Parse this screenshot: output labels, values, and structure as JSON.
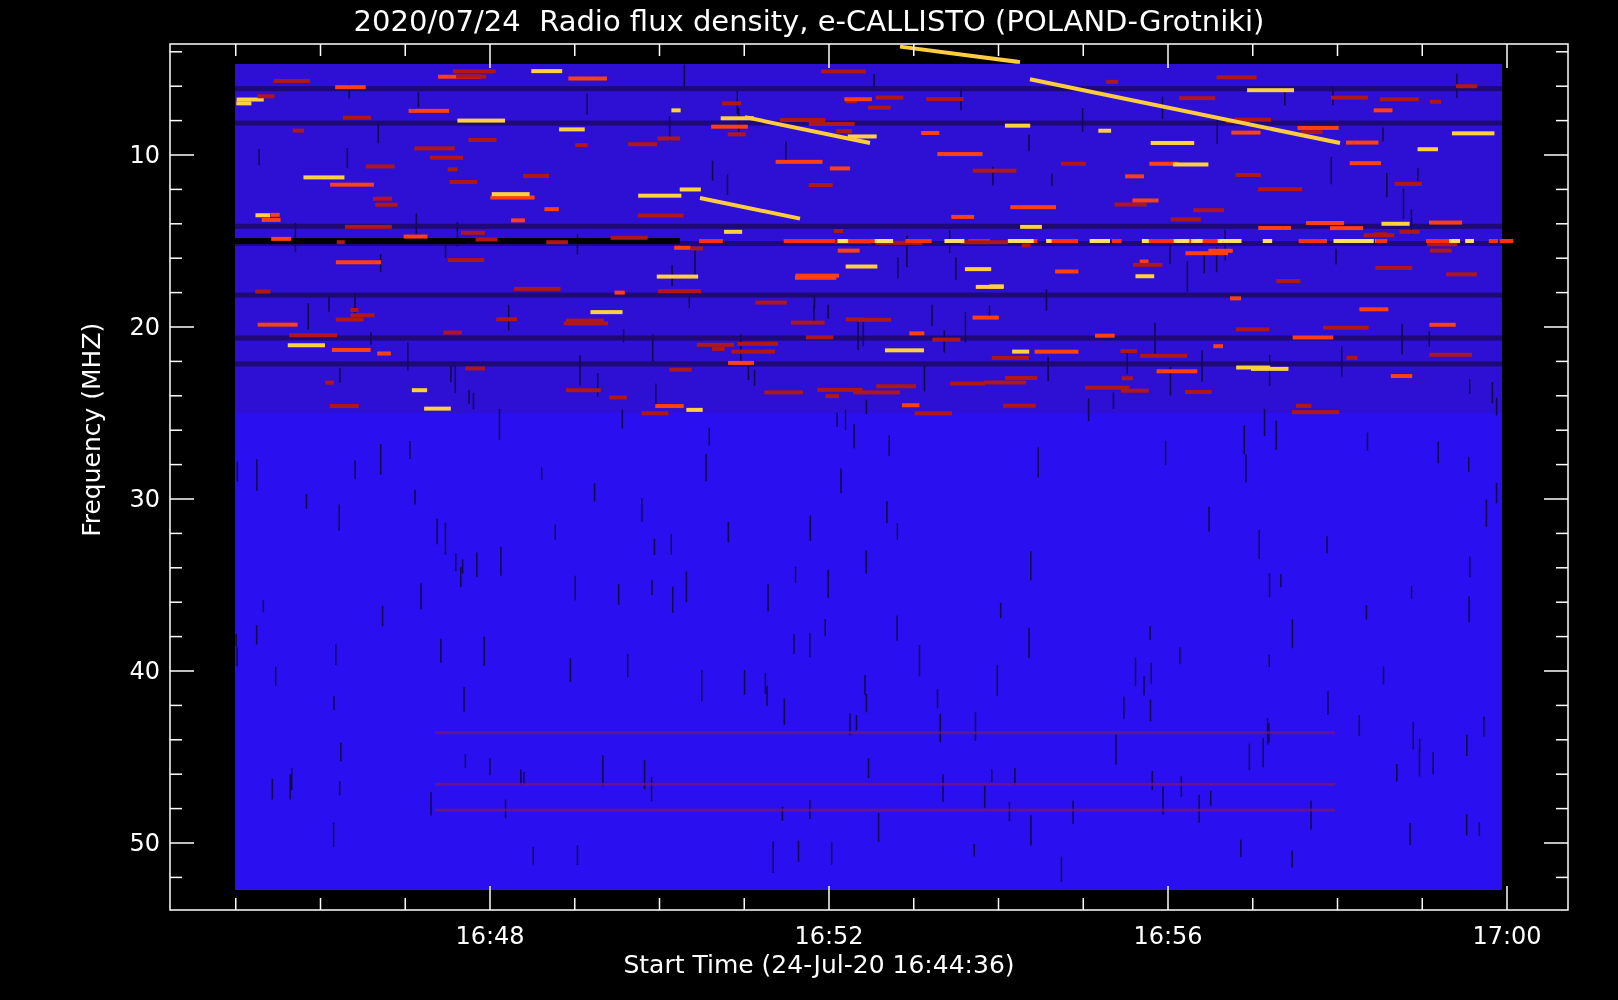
{
  "title": "2020/07/24  Radio flux density, e-CALLISTO (POLAND-Grotniki)",
  "y_axis": {
    "label": "Frequency (MHZ)",
    "ticks": [
      "10",
      "20",
      "30",
      "40",
      "50"
    ]
  },
  "x_axis": {
    "label": "Start Time (24-Jul-20 16:44:36)",
    "ticks": [
      "16:48",
      "16:52",
      "16:56",
      "17:00"
    ]
  }
}
